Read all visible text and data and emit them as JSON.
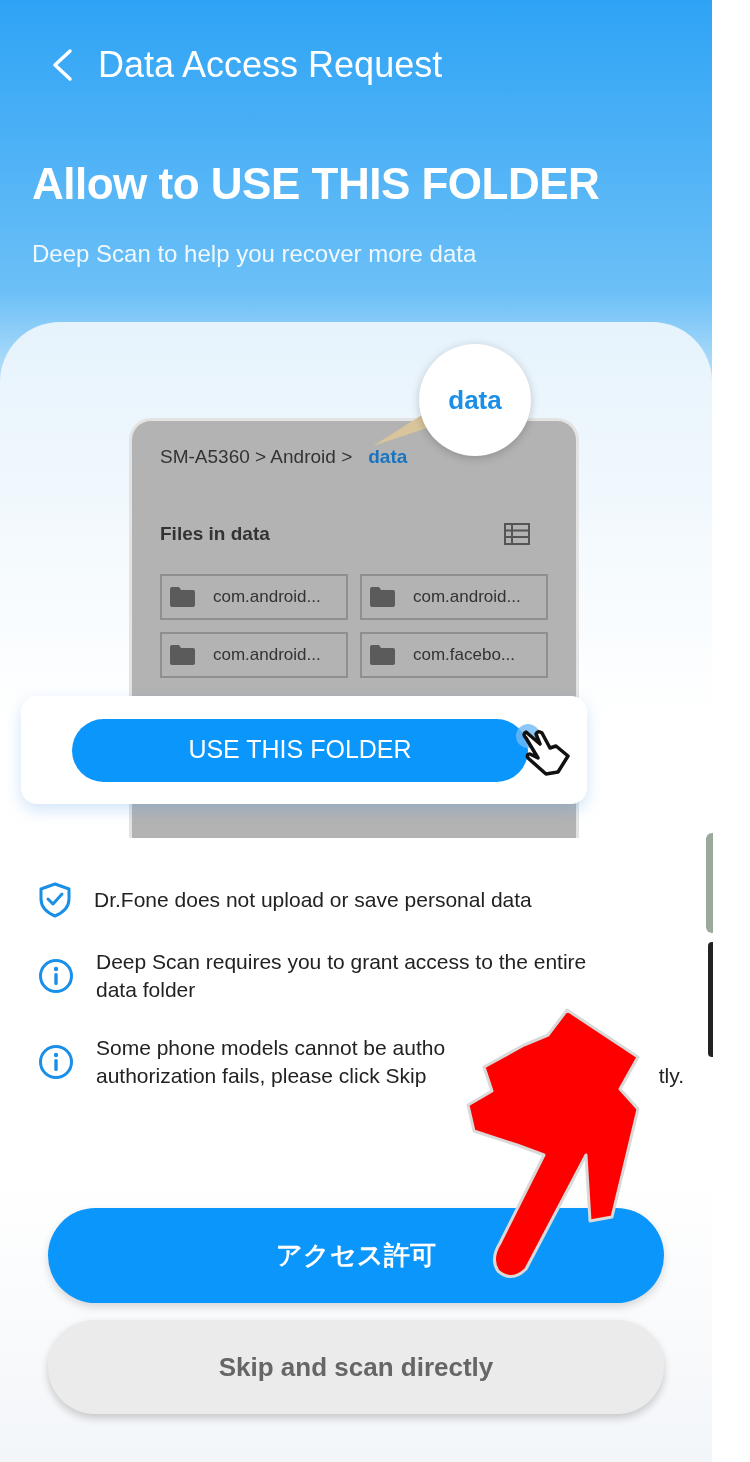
{
  "header": {
    "title": "Data Access Request"
  },
  "hero": {
    "headline": "Allow to USE THIS FOLDER",
    "subtitle": "Deep Scan to help you recover more data"
  },
  "illustration": {
    "callout": "data",
    "breadcrumb": [
      "SM-A5360 > Android >",
      "data"
    ],
    "files_title": "Files in data",
    "folders": [
      "com.android...",
      "com.android...",
      "com.android...",
      "com.facebo..."
    ],
    "button": "USE THIS FOLDER"
  },
  "notes": [
    {
      "kind": "shield",
      "lines": [
        [
          "Dr.Fone does not upload or save personal data"
        ]
      ]
    },
    {
      "kind": "info",
      "lines": [
        [
          "Deep Scan requires you to grant access to the entire"
        ],
        [
          "data folder"
        ]
      ]
    },
    {
      "kind": "info",
      "lines": [
        [
          "Some phone models cannot be autho"
        ],
        [
          "authorization fails, please click Skip",
          "tly."
        ]
      ]
    }
  ],
  "primary_button": "アクセス許可",
  "secondary_button": "Skip and scan directly"
}
